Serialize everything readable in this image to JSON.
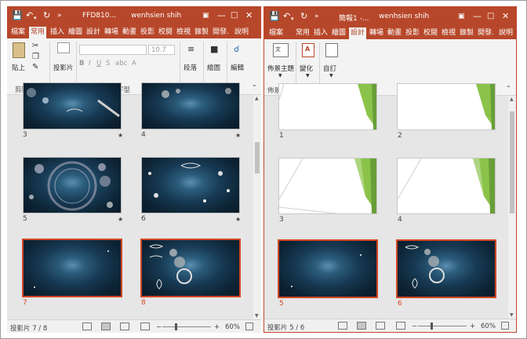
{
  "left": {
    "doc_title": "FFD810...",
    "user": "wenhsien shih",
    "tabs": [
      "檔案",
      "常用",
      "插入",
      "繪圖",
      "設計",
      "轉場",
      "動畫",
      "投影",
      "校閱",
      "檢視",
      "錄製",
      "開發.",
      "說明"
    ],
    "active_tab": "常用",
    "ribbon": {
      "paste": "貼上",
      "clipboard_group": "剪貼簿",
      "slides_btn": "投影片",
      "font_group": "字型",
      "font_size": "10.7",
      "paragraph": "段落",
      "drawing": "繪圖",
      "editing": "編輯"
    },
    "slides": [
      {
        "num": "3",
        "star": "★"
      },
      {
        "num": "4",
        "star": "★"
      },
      {
        "num": "5",
        "star": "★"
      },
      {
        "num": "6",
        "star": "★"
      },
      {
        "num": "7",
        "star": ""
      },
      {
        "num": "8",
        "star": ""
      }
    ],
    "status": {
      "slide_info": "投影片 7 / 8",
      "zoom": "60%"
    }
  },
  "right": {
    "doc_title": "簡報1 -...",
    "user": "wenhsien shih",
    "tabs": [
      "檔案",
      "常用",
      "插入",
      "繪圖",
      "設計",
      "轉場",
      "動畫",
      "投影",
      "校閱",
      "檢視",
      "錄製",
      "開發.",
      "說明"
    ],
    "active_tab": "設計",
    "ribbon": {
      "themes": "佈景主題",
      "variants": "變化",
      "customize": "自訂",
      "themes_group": "佈景主題"
    },
    "slides": [
      {
        "num": "1"
      },
      {
        "num": "2"
      },
      {
        "num": "3"
      },
      {
        "num": "4"
      },
      {
        "num": "5"
      },
      {
        "num": "6"
      }
    ],
    "status": {
      "slide_info": "投影片 5 / 6",
      "zoom": "60%"
    }
  },
  "colors": {
    "accent": "#b7472a",
    "selection": "#d24726",
    "green": "#7cb342"
  }
}
